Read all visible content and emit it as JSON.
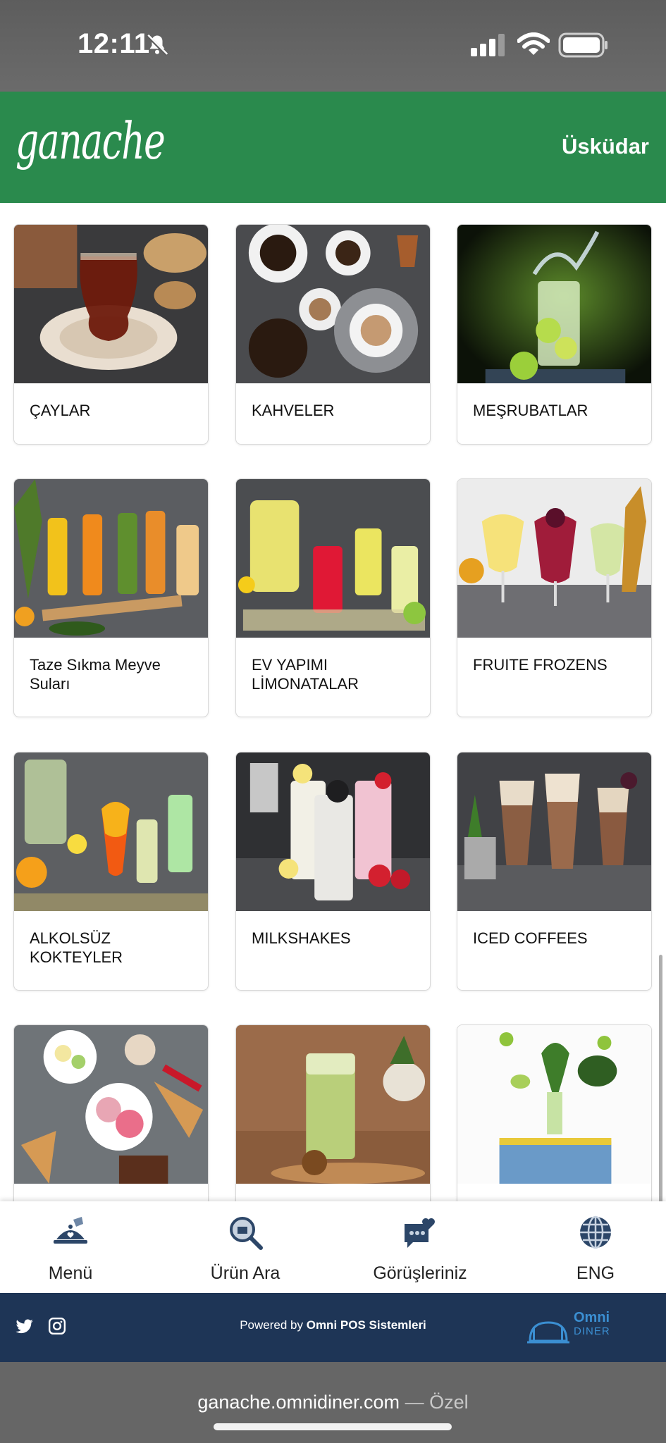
{
  "status_bar": {
    "time": "12:11"
  },
  "header": {
    "logo": "ganache",
    "branch": "Üsküdar"
  },
  "categories": [
    {
      "label": "ÇAYLAR",
      "image": "tea-glass"
    },
    {
      "label": "KAHVELER",
      "image": "coffee-cups"
    },
    {
      "label": "MEŞRUBATLAR",
      "image": "splashing-soda"
    },
    {
      "label": "Taze Sıkma Meyve Suları",
      "image": "fresh-juices"
    },
    {
      "label": "EV YAPIMI LİMONATALAR",
      "image": "homemade-lemonades"
    },
    {
      "label": "FRUITE FROZENS",
      "image": "frozen-drinks"
    },
    {
      "label": "ALKOLSÜZ KOKTEYLER",
      "image": "mocktails"
    },
    {
      "label": "MILKSHAKES",
      "image": "milkshakes"
    },
    {
      "label": "ICED COFFEES",
      "image": "iced-coffees"
    },
    {
      "label": "",
      "image": "ice-cream"
    },
    {
      "label": "",
      "image": "green-drink"
    },
    {
      "label": "",
      "image": "healthy-greens"
    }
  ],
  "bottom_nav": [
    {
      "label": "Menü",
      "icon": "menu-cloche-icon"
    },
    {
      "label": "Ürün Ara",
      "icon": "product-search-icon"
    },
    {
      "label": "Görüşleriniz",
      "icon": "feedback-heart-icon"
    },
    {
      "label": "ENG",
      "icon": "globe-icon"
    }
  ],
  "footer": {
    "powered_prefix": "Powered by",
    "powered_brand": "Omni POS Sistemleri",
    "omni_logo": "Omni",
    "omni_logo_sub": "DINER"
  },
  "browser": {
    "url": "ganache.omnidiner.com",
    "mode": "— Özel"
  },
  "colors": {
    "header": "#2a8a4d",
    "footer": "#1e3556",
    "nav_icon": "#2c4668"
  }
}
